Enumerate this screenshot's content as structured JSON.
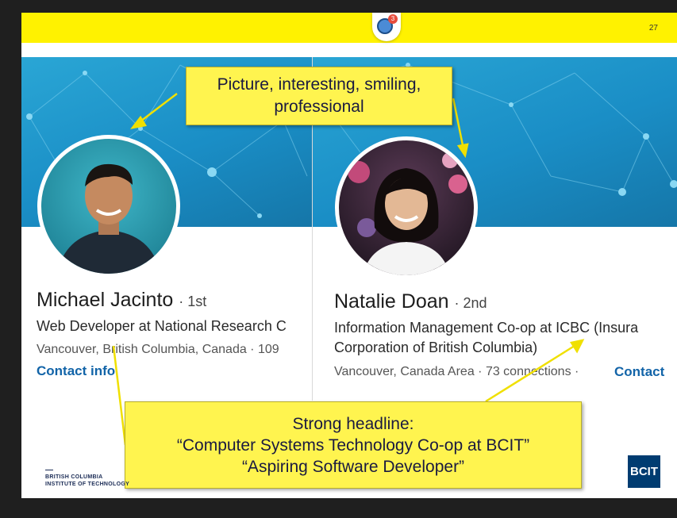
{
  "slide": {
    "page_number": "27",
    "chat_badge_count": "3"
  },
  "left_profile": {
    "name": "Michael Jacinto",
    "degree": "· 1st",
    "headline": "Web Developer at National Research C",
    "location": "Vancouver, British Columbia, Canada  ·  109",
    "contact": "Contact info"
  },
  "right_profile": {
    "name": "Natalie Doan",
    "degree": "· 2nd",
    "headline_line1": "Information Management Co-op at ICBC (Insura",
    "headline_line2": "Corporation of British Columbia)",
    "location": "Vancouver, Canada Area  ·  73 connections  ·",
    "contact": "Contact"
  },
  "callouts": {
    "picture_line1": "Picture, interesting, smiling,",
    "picture_line2": "professional",
    "headline_line1": "Strong headline:",
    "headline_line2": "“Computer Systems Technology Co-op at BCIT”",
    "headline_line3": "“Aspiring Software Developer”"
  },
  "footer": {
    "institute_line1": "BRITISH COLUMBIA",
    "institute_line2": "INSTITUTE OF TECHNOLOGY",
    "logo_text": "BCIT"
  },
  "colors": {
    "topbar": "#fff200",
    "banner": "#1a8ec6",
    "link": "#1264a8",
    "callout": "#fff44f",
    "bcit_blue": "#003c71"
  }
}
